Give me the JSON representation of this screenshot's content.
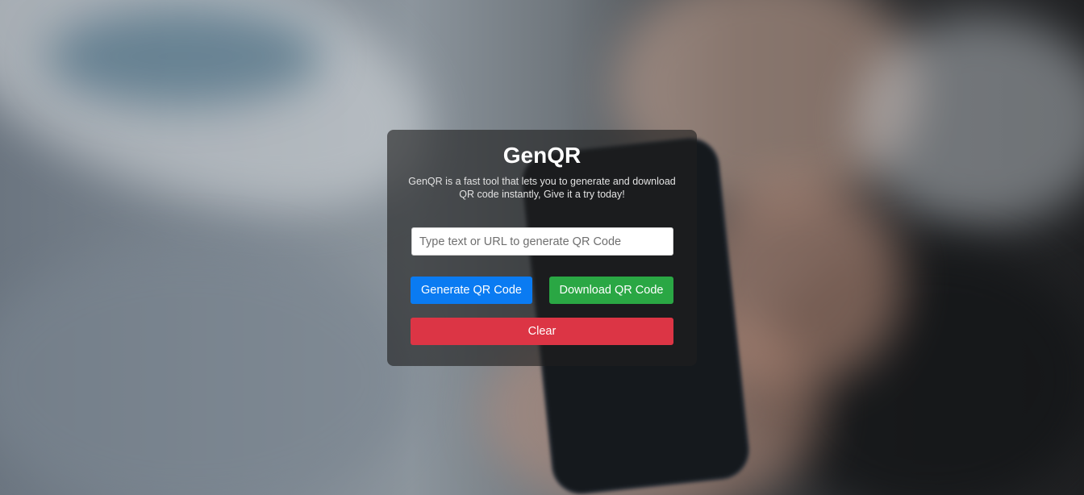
{
  "app": {
    "title": "GenQR",
    "description": "GenQR is a fast tool that lets you to generate and download QR code instantly, Give it a try today!"
  },
  "form": {
    "input_placeholder": "Type text or URL to generate QR Code",
    "input_value": ""
  },
  "buttons": {
    "generate_label": "Generate QR Code",
    "download_label": "Download QR Code",
    "clear_label": "Clear"
  },
  "colors": {
    "generate": "#0a7bf2",
    "download": "#2aa744",
    "clear": "#dc3545",
    "card_overlay": "rgba(30,30,30,0.62)"
  }
}
